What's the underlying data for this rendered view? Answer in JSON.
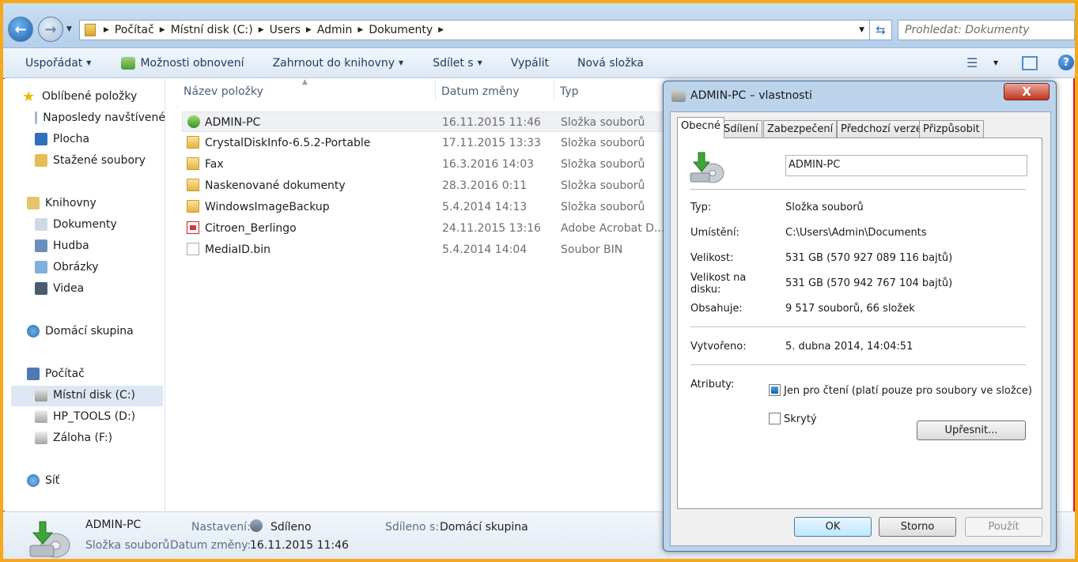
{
  "address": {
    "breadcrumbs": [
      "Počítač",
      "Místní disk (C:)",
      "Users",
      "Admin",
      "Dokumenty"
    ],
    "search_placeholder": "Prohledat: Dokumenty"
  },
  "toolbar": {
    "organize": "Uspořádat",
    "restore": "Možnosti obnovení",
    "include": "Zahrnout do knihovny",
    "share": "Sdílet s",
    "burn": "Vypálit",
    "new_folder": "Nová složka"
  },
  "nav": {
    "favorites": "Oblíbené položky",
    "recent": "Naposledy navštívené",
    "desktop": "Plocha",
    "downloads": "Stažené soubory",
    "libraries": "Knihovny",
    "documents": "Dokumenty",
    "music": "Hudba",
    "pictures": "Obrázky",
    "videos": "Videa",
    "homegroup": "Domácí skupina",
    "computer": "Počítač",
    "drive_c": "Místní disk (C:)",
    "drive_d": "HP_TOOLS (D:)",
    "drive_f": "Záloha (F:)",
    "network": "Síť"
  },
  "filelist": {
    "columns": [
      "Název položky",
      "Datum změny",
      "Typ"
    ],
    "rows": [
      {
        "name": "ADMIN-PC",
        "date": "16.11.2015 11:46",
        "type": "Složka souborů",
        "icon": "shared-folder-icon"
      },
      {
        "name": "CrystalDiskInfo-6.5.2-Portable",
        "date": "17.11.2015 13:33",
        "type": "Složka souborů",
        "icon": "folder-icon"
      },
      {
        "name": "Fax",
        "date": "16.3.2016 14:03",
        "type": "Složka souborů",
        "icon": "folder-icon"
      },
      {
        "name": "Naskenované dokumenty",
        "date": "28.3.2016 0:11",
        "type": "Složka souborů",
        "icon": "folder-icon"
      },
      {
        "name": "WindowsImageBackup",
        "date": "5.4.2014 14:13",
        "type": "Složka souborů",
        "icon": "folder-icon"
      },
      {
        "name": "Citroen_Berlingo",
        "date": "24.11.2015 13:16",
        "type": "Adobe Acrobat D...",
        "icon": "pdf-icon"
      },
      {
        "name": "MediaID.bin",
        "date": "5.4.2014 14:04",
        "type": "Soubor BIN",
        "icon": "file-icon"
      }
    ]
  },
  "status": {
    "name": "ADMIN-PC",
    "type": "Složka souborů",
    "settings_label": "Nastavení:",
    "settings_value": "Sdíleno",
    "shared_label": "Sdíleno s:",
    "shared_value": "Domácí skupina",
    "modified_label": "Datum změny:",
    "modified_value": "16.11.2015 11:46"
  },
  "dialog": {
    "title": "ADMIN-PC – vlastnosti",
    "close": "X",
    "tabs": [
      "Obecné",
      "Sdílení",
      "Zabezpečení",
      "Předchozí verze",
      "Přizpůsobit"
    ],
    "name": "ADMIN-PC",
    "props": {
      "type_label": "Typ:",
      "type_value": "Složka souborů",
      "location_label": "Umístění:",
      "location_value": "C:\\Users\\Admin\\Documents",
      "size_label": "Velikost:",
      "size_value": "531 GB (570 927 089 116 bajtů)",
      "disk_label": "Velikost na disku:",
      "disk_value": "531 GB (570 942 767 104 bajtů)",
      "contains_label": "Obsahuje:",
      "contains_value": "9 517 souborů, 66 složek",
      "created_label": "Vytvořeno:",
      "created_value": "5. dubna 2014, 14:04:51",
      "attr_label": "Atributy:",
      "readonly": "Jen pro čtení (platí pouze pro soubory ve složce)",
      "hidden": "Skrytý",
      "advanced": "Upřesnit..."
    },
    "ok": "OK",
    "cancel": "Storno",
    "apply": "Použít"
  }
}
